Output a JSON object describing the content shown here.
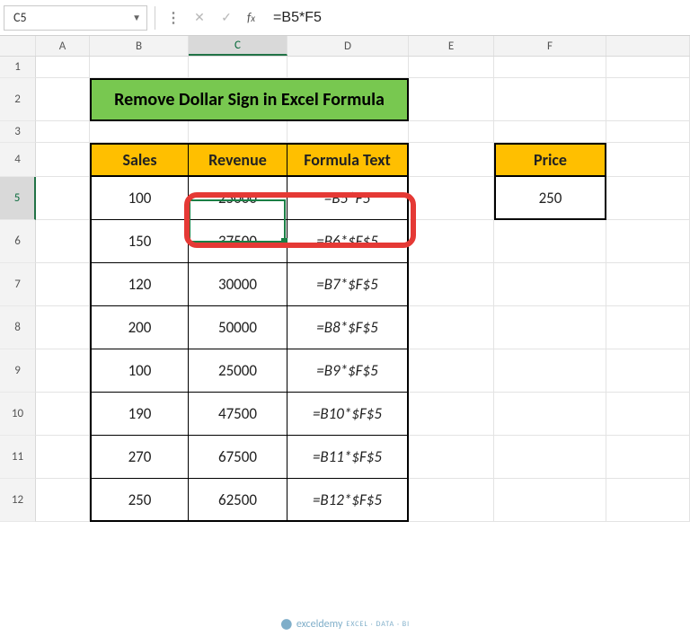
{
  "name_box": "C5",
  "formula": "=B5*F5",
  "columns": [
    "A",
    "B",
    "C",
    "D",
    "E",
    "F"
  ],
  "selected_col": "C",
  "row_numbers": [
    1,
    2,
    3,
    4,
    5,
    6,
    7,
    8,
    9,
    10,
    11,
    12
  ],
  "selected_row": 5,
  "title": "Remove Dollar Sign in Excel Formula",
  "headers": {
    "b": "Sales",
    "c": "Revenue",
    "d": "Formula Text",
    "f": "Price"
  },
  "price_value": "250",
  "tbl": [
    {
      "sales": "100",
      "rev": "25000",
      "ft": "=B5*F5"
    },
    {
      "sales": "150",
      "rev": "37500",
      "ft": "=B6*$F$5"
    },
    {
      "sales": "120",
      "rev": "30000",
      "ft": "=B7*$F$5"
    },
    {
      "sales": "200",
      "rev": "50000",
      "ft": "=B8*$F$5"
    },
    {
      "sales": "100",
      "rev": "25000",
      "ft": "=B9*$F$5"
    },
    {
      "sales": "190",
      "rev": "47500",
      "ft": "=B10*$F$5"
    },
    {
      "sales": "270",
      "rev": "67500",
      "ft": "=B11*$F$5"
    },
    {
      "sales": "250",
      "rev": "62500",
      "ft": "=B12*$F$5"
    }
  ],
  "watermark": {
    "brand": "exceldemy",
    "tag": "EXCEL · DATA · BI"
  },
  "chart_data": {
    "type": "table",
    "title": "Remove Dollar Sign in Excel Formula",
    "columns": [
      "Sales",
      "Revenue",
      "Formula Text"
    ],
    "rows": [
      [
        100,
        25000,
        "=B5*F5"
      ],
      [
        150,
        37500,
        "=B6*$F$5"
      ],
      [
        120,
        30000,
        "=B7*$F$5"
      ],
      [
        200,
        50000,
        "=B8*$F$5"
      ],
      [
        100,
        25000,
        "=B9*$F$5"
      ],
      [
        190,
        47500,
        "=B10*$F$5"
      ],
      [
        270,
        67500,
        "=B11*$F$5"
      ],
      [
        250,
        62500,
        "=B12*$F$5"
      ]
    ],
    "aux": {
      "Price": 250
    }
  }
}
